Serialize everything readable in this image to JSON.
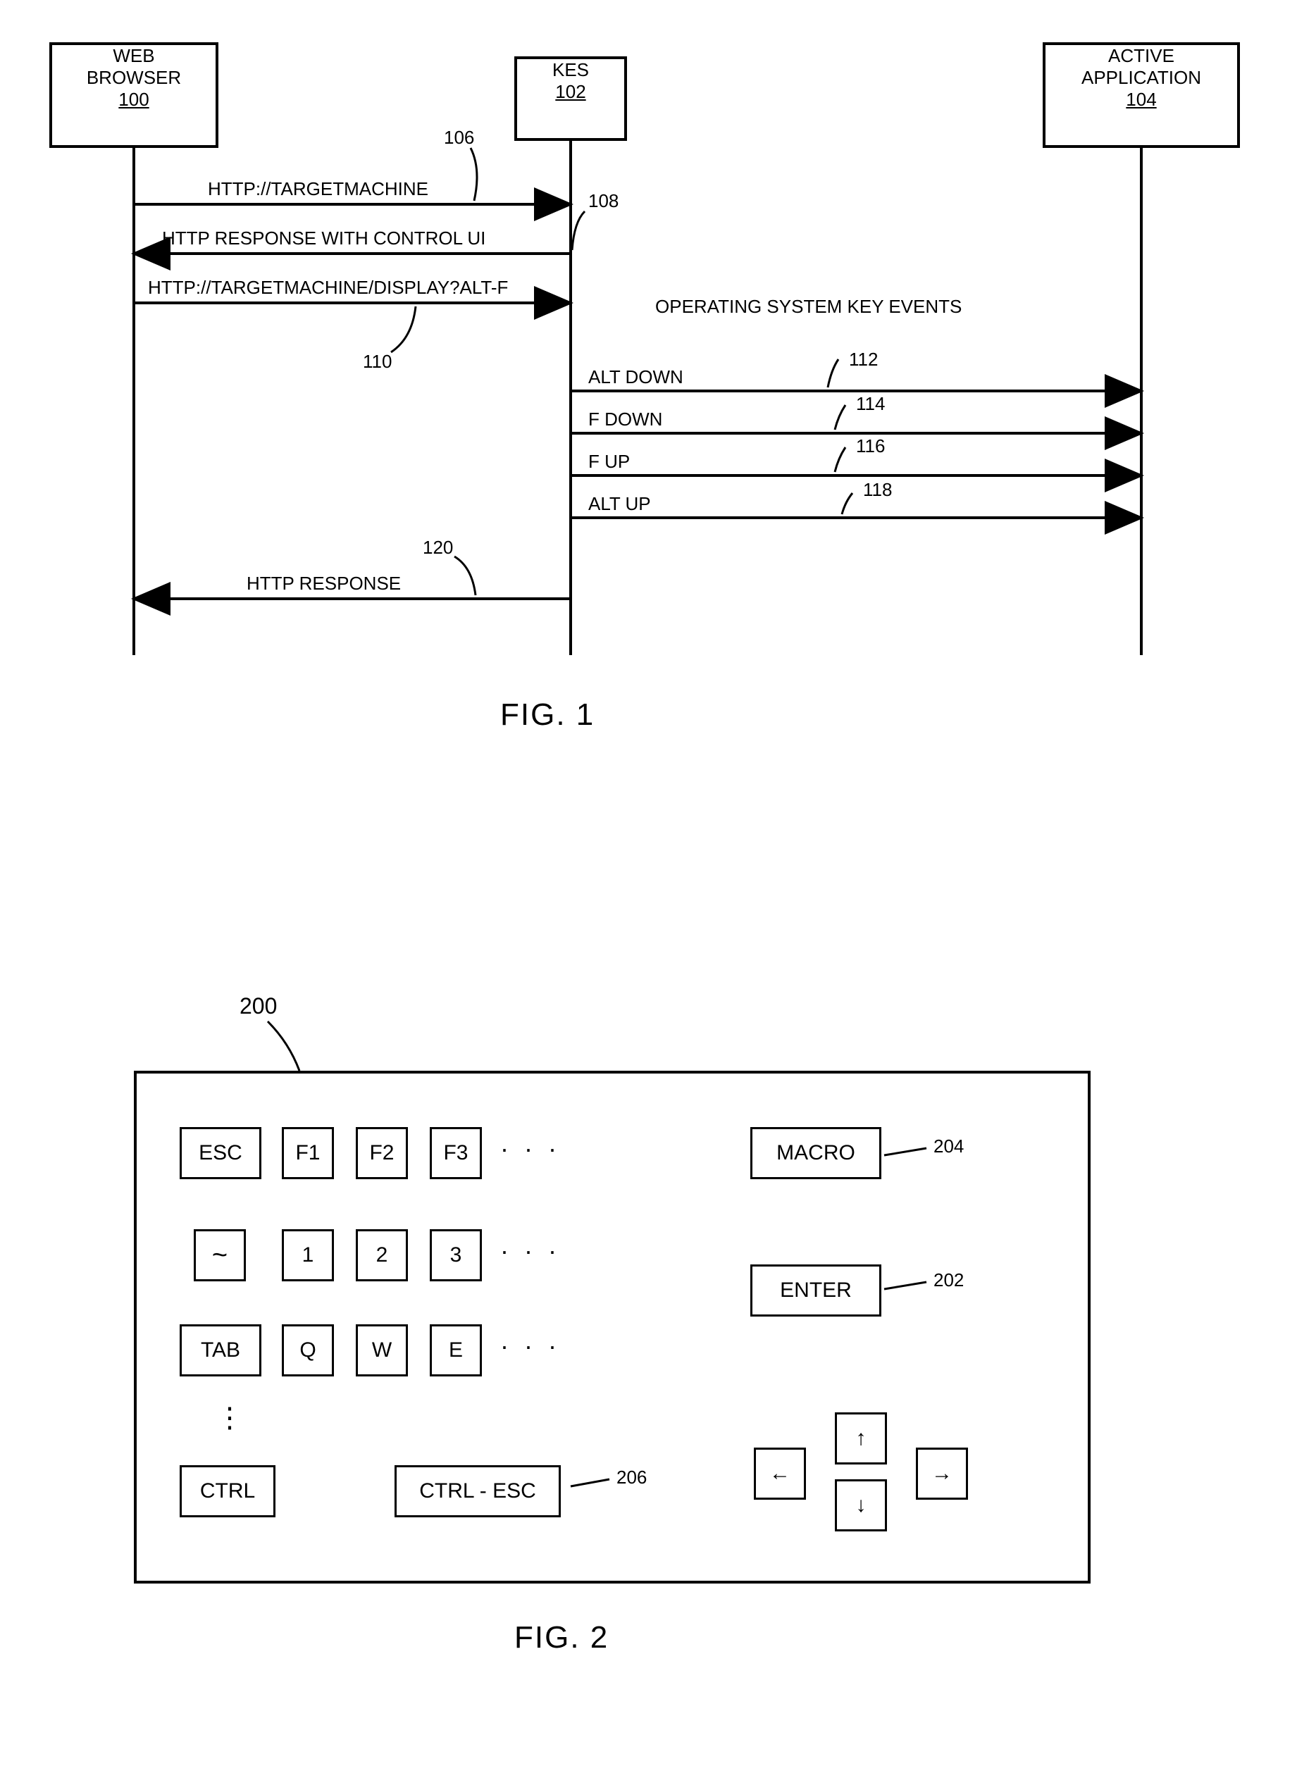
{
  "fig1": {
    "participants": {
      "web": {
        "line1": "WEB",
        "line2": "BROWSER",
        "id": "100"
      },
      "kes": {
        "line1": "KES",
        "id": "102"
      },
      "app": {
        "line1": "ACTIVE",
        "line2": "APPLICATION",
        "id": "104"
      }
    },
    "messages": {
      "m106": "HTTP://TARGETMACHINE",
      "m108": "HTTP RESPONSE WITH CONTROL UI",
      "m110": "HTTP://TARGETMACHINE/DISPLAY?ALT-F",
      "group": "OPERATING SYSTEM KEY EVENTS",
      "m112": "ALT DOWN",
      "m114": "F DOWN",
      "m116": "F UP",
      "m118": "ALT UP",
      "m120": "HTTP RESPONSE"
    },
    "refs": {
      "r106": "106",
      "r108": "108",
      "r110": "110",
      "r112": "112",
      "r114": "114",
      "r116": "116",
      "r118": "118",
      "r120": "120"
    },
    "caption": "FIG. 1"
  },
  "fig2": {
    "ref": "200",
    "keys": {
      "esc": "ESC",
      "f1": "F1",
      "f2": "F2",
      "f3": "F3",
      "tilde": "~",
      "k1": "1",
      "k2": "2",
      "k3": "3",
      "tab": "TAB",
      "q": "Q",
      "w": "W",
      "e": "E",
      "ctrl": "CTRL",
      "ctrlesc": "CTRL - ESC",
      "macro": "MACRO",
      "enter": "ENTER",
      "up": "↑",
      "down": "↓",
      "left": "←",
      "right": "→",
      "dots": "· · ·",
      "vdots": "⋮"
    },
    "refs": {
      "r202": "202",
      "r204": "204",
      "r206": "206"
    },
    "caption": "FIG. 2"
  }
}
